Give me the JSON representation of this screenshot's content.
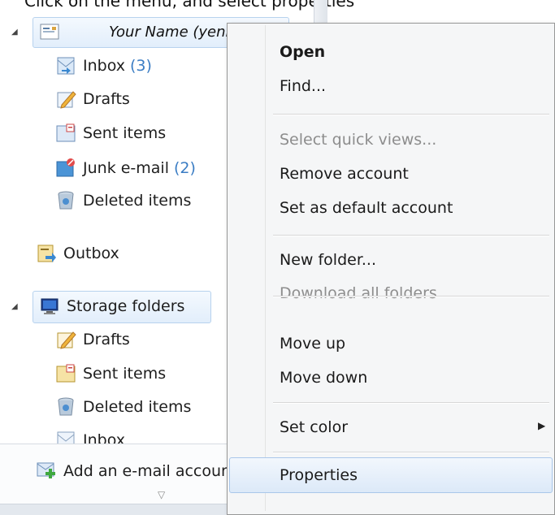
{
  "caption": "Click on the menu, and select properties",
  "tree": {
    "account_name": "Your Name (yenish)",
    "account_folders": [
      {
        "label": "Inbox",
        "count": "(3)",
        "icon": "inbox-icon"
      },
      {
        "label": "Drafts",
        "count": "",
        "icon": "drafts-icon"
      },
      {
        "label": "Sent items",
        "count": "",
        "icon": "sent-items-icon"
      },
      {
        "label": "Junk e-mail",
        "count": "(2)",
        "icon": "junk-mail-icon"
      },
      {
        "label": "Deleted items",
        "count": "",
        "icon": "deleted-items-icon"
      }
    ],
    "outbox": "Outbox",
    "storage_label": "Storage folders",
    "storage_folders": [
      {
        "label": "Drafts",
        "icon": "drafts-icon"
      },
      {
        "label": "Sent items",
        "icon": "sent-items-icon"
      },
      {
        "label": "Deleted items",
        "icon": "deleted-items-icon"
      },
      {
        "label": "Inbox",
        "icon": "inbox-icon"
      }
    ],
    "add_account": "Add an e-mail account"
  },
  "context_menu": {
    "items": [
      {
        "label": "Open",
        "style": "bold"
      },
      {
        "label": "Find...",
        "style": "normal"
      },
      {
        "label": "Select quick views...",
        "style": "disabled"
      },
      {
        "label": "Remove account",
        "style": "normal"
      },
      {
        "label": "Set as default account",
        "style": "normal"
      },
      {
        "label": "New folder...",
        "style": "normal"
      },
      {
        "label": "Download all folders",
        "style": "disabled"
      },
      {
        "label": "Move up",
        "style": "normal"
      },
      {
        "label": "Move down",
        "style": "normal"
      },
      {
        "label": "Set color",
        "style": "normal"
      },
      {
        "label": "Properties",
        "style": "highlighted"
      }
    ]
  },
  "colors": {
    "count": "#3b7dc4",
    "selection": "#dce9f8",
    "menu_bg": "#f5f6f7"
  }
}
